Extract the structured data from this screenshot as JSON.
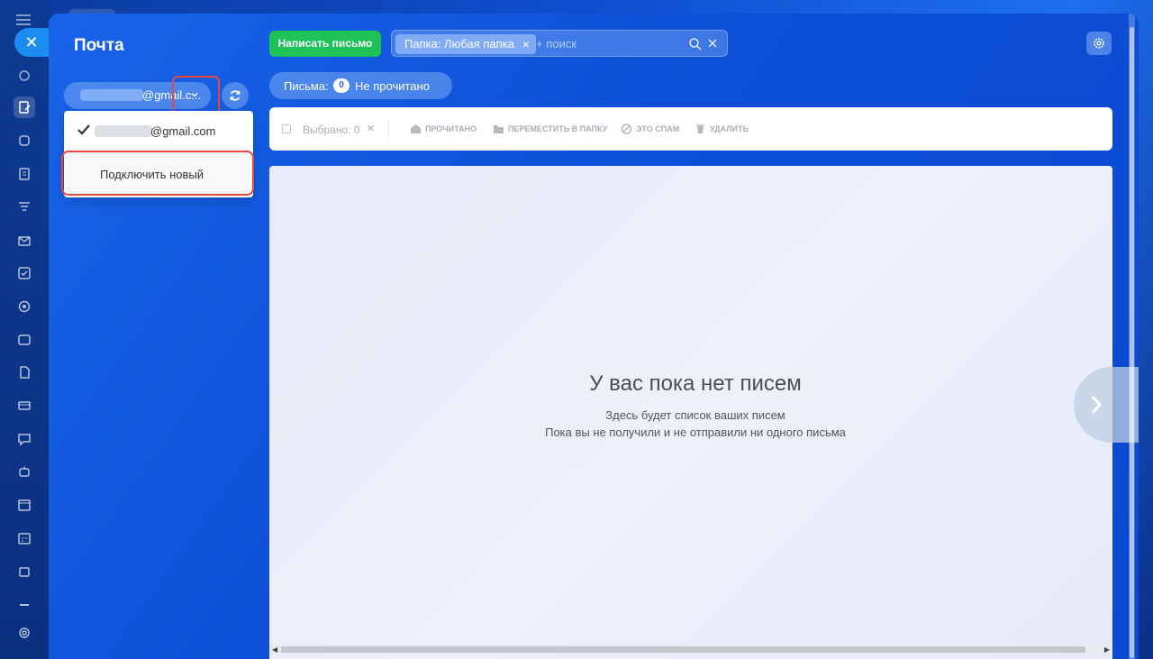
{
  "panel": {
    "title": "Почта"
  },
  "account": {
    "selected_email": "@gmail.c...",
    "dropdown": {
      "current_email": "@gmail.com",
      "connect_new": "Подключить новый"
    }
  },
  "header": {
    "compose_label": "Написать письмо",
    "search": {
      "filter_chip": "Папка: Любая папка",
      "placeholder": "+ поиск"
    }
  },
  "counter": {
    "label": "Письма:",
    "count": "0",
    "filter": "Не прочитано"
  },
  "toolbar": {
    "selected": "Выбрано: 0",
    "actions": [
      {
        "label": "ПРОЧИТАНО",
        "icon": "envelope-open-icon"
      },
      {
        "label": "ПЕРЕМЕСТИТЬ В ПАПКУ",
        "icon": "folder-icon"
      },
      {
        "label": "ЭТО СПАМ",
        "icon": "spam-icon"
      },
      {
        "label": "УДАЛИТЬ",
        "icon": "trash-icon"
      }
    ]
  },
  "empty_state": {
    "title": "У вас пока нет писем",
    "line1": "Здесь будет список ваших писем",
    "line2": "Пока вы не получили и не отправили ни одного письма"
  },
  "colors": {
    "accent": "#1d63e0",
    "compose": "#1ec258",
    "highlight": "#e8483f"
  }
}
